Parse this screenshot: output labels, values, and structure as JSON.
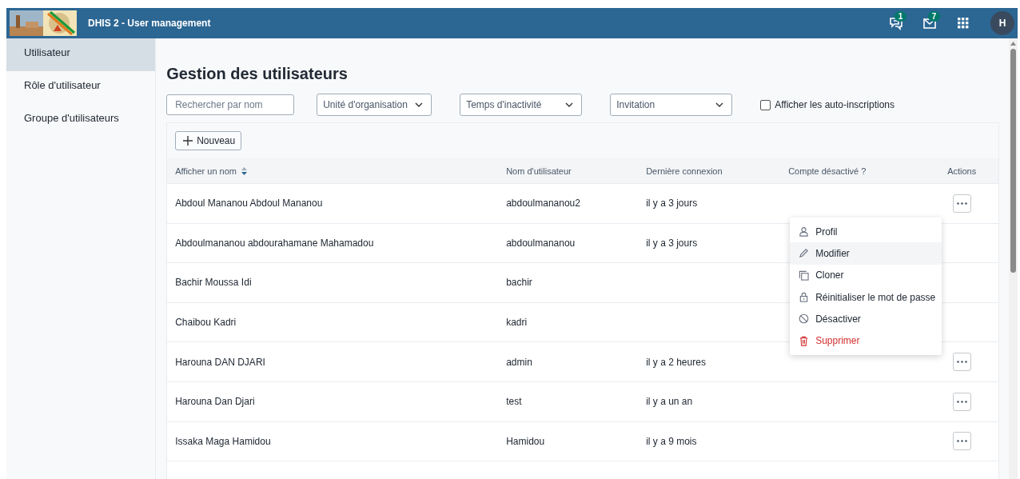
{
  "header": {
    "title": "DHIS 2 - User management",
    "interpretations_count": "1",
    "messages_count": "7",
    "avatar": "H"
  },
  "sidebar": {
    "items": [
      {
        "label": "Utilisateur",
        "selected": true
      },
      {
        "label": "Rôle d'utilisateur",
        "selected": false
      },
      {
        "label": "Groupe d'utilisateurs",
        "selected": false
      }
    ]
  },
  "page_title": "Gestion des utilisateurs",
  "filters": {
    "search": {
      "placeholder": "Rechercher par nom"
    },
    "selects": [
      {
        "label": "Unité d'organisation"
      },
      {
        "label": "Temps d'inactivité"
      },
      {
        "label": "Invitation"
      }
    ],
    "self_registered": {
      "label": "Afficher les auto-inscriptions",
      "checked": false
    }
  },
  "new_button": "Nouveau",
  "table": {
    "columns": [
      "Afficher un nom",
      "Nom d'utilisateur",
      "Dernière connexion",
      "Compte désactivé ?",
      "Actions"
    ],
    "rows": [
      {
        "display_name": "Abdoul Mananou Abdoul Mananou",
        "username": "abdoulmananou2",
        "last_login": "il y a 3 jours",
        "actions_button": true
      },
      {
        "display_name": "Abdoulmananou abdourahamane Mahamadou",
        "username": "abdoulmananou",
        "last_login": "il y a 3 jours",
        "actions_button": false
      },
      {
        "display_name": "Bachir Moussa Idi",
        "username": "bachir",
        "last_login": "",
        "actions_button": false
      },
      {
        "display_name": "Chaibou Kadri",
        "username": "kadri",
        "last_login": "",
        "actions_button": false
      },
      {
        "display_name": "Harouna DAN DJARI",
        "username": "admin",
        "last_login": "il y a 2 heures",
        "actions_button": true
      },
      {
        "display_name": "Harouna Dan Djari",
        "username": "test",
        "last_login": "il y a un an",
        "actions_button": true
      },
      {
        "display_name": "Issaka Maga Hamidou",
        "username": "Hamidou",
        "last_login": "il y a 9 mois",
        "actions_button": true
      }
    ]
  },
  "context_menu": {
    "items": [
      {
        "label": "Profil",
        "kind": "profile",
        "selected": false
      },
      {
        "label": "Modifier",
        "kind": "edit",
        "selected": true
      },
      {
        "label": "Cloner",
        "kind": "clone",
        "selected": false
      },
      {
        "label": "Réinitialiser le mot de passe",
        "kind": "reset",
        "selected": false
      },
      {
        "label": "Désactiver",
        "kind": "disable",
        "selected": false
      },
      {
        "label": "Supprimer",
        "kind": "delete",
        "selected": false
      }
    ]
  }
}
